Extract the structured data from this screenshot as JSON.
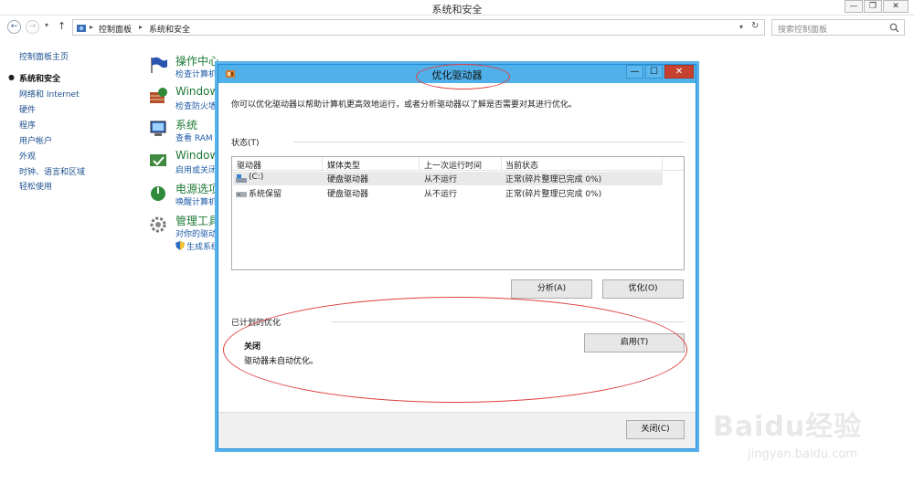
{
  "window": {
    "title": "系统和安全",
    "minimize": "—",
    "restore": "❐",
    "close": "✕"
  },
  "address_bar": {
    "back": "←",
    "forward": "→",
    "up": "↑",
    "path": [
      "控制面板",
      "系统和安全"
    ],
    "separator": "▸",
    "dropdown": "▾",
    "refresh": "↻",
    "search_placeholder": "搜索控制面板"
  },
  "sidebar": {
    "home": "控制面板主页",
    "items": [
      {
        "label": "系统和安全",
        "current": true
      },
      {
        "label": "网络和 Internet"
      },
      {
        "label": "硬件"
      },
      {
        "label": "程序"
      },
      {
        "label": "用户帐户"
      },
      {
        "label": "外观"
      },
      {
        "label": "时钟、语言和区域"
      },
      {
        "label": "轻松使用"
      }
    ]
  },
  "categories": [
    {
      "title": "操作中心",
      "sub": "检查计算机",
      "icon": "flag-icon"
    },
    {
      "title": "Window",
      "sub": "检查防火墙",
      "icon": "firewall-icon"
    },
    {
      "title": "系统",
      "sub": "查看 RAM",
      "icon": "system-icon"
    },
    {
      "title": "Window",
      "sub": "启用或关闭",
      "icon": "update-icon"
    },
    {
      "title": "电源选项",
      "sub": "唤醒计算机",
      "icon": "power-icon"
    },
    {
      "title": "管理工具",
      "sub": "对你的驱动",
      "sub2": "生成系统",
      "icon": "tools-icon"
    }
  ],
  "dialog": {
    "title": "优化驱动器",
    "intro": "你可以优化驱动器以帮助计算机更高效地运行，或者分析驱动器以了解是否需要对其进行优化。",
    "status_label": "状态(T)",
    "columns": [
      "驱动器",
      "媒体类型",
      "上一次运行时间",
      "当前状态"
    ],
    "drives": [
      {
        "name": "(C:)",
        "media": "硬盘驱动器",
        "last_run": "从不运行",
        "status": "正常(碎片整理已完成 0%)",
        "selected": true
      },
      {
        "name": "系统保留",
        "media": "硬盘驱动器",
        "last_run": "从不运行",
        "status": "正常(碎片整理已完成 0%)",
        "selected": false
      }
    ],
    "analyze_button": "分析(A)",
    "optimize_button": "优化(O)",
    "scheduled_label": "已计划的优化",
    "scheduled_state": "关闭",
    "scheduled_desc": "驱动器未自动优化。",
    "enable_button": "启用(T)",
    "close_button": "关闭(C)",
    "minimize": "—",
    "maximize": "☐",
    "close": "✕"
  },
  "watermark": {
    "brand": "Baidu经验",
    "url": "jingyan.baidu.com"
  },
  "colors": {
    "dialog_accent": "#4fb0ea",
    "close_red": "#c7412f",
    "link_blue": "#1d4f8f",
    "category_green": "#1e7a35",
    "annotation_red": "#e04040"
  }
}
